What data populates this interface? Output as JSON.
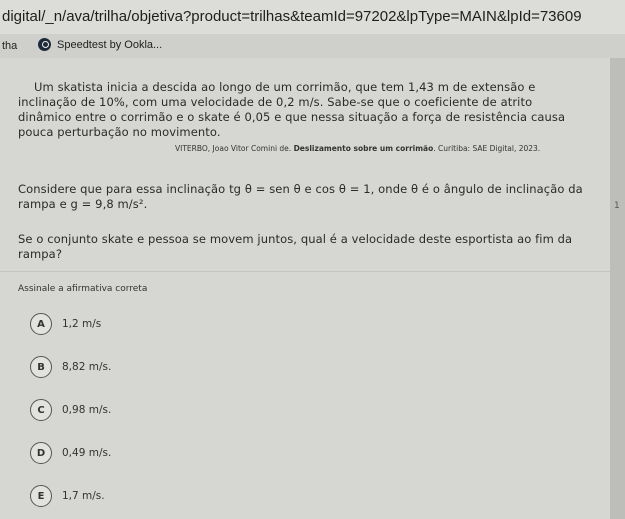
{
  "browser": {
    "url": "digital/_n/ava/trilha/objetiva?product=trilhas&teamId=97202&lpType=MAIN&lpId=73609",
    "bookmark_left": "tha",
    "bookmark_item": "Speedtest by Ookla..."
  },
  "question": {
    "paragraph1": "Um skatista inicia a descida ao longo de um corrimão, que tem 1,43 m de extensão e inclinação de 10%, com uma velocidade de 0,2 m/s. Sabe-se que o coeficiente de atrito dinâmico entre o corrimão e o skate é 0,05 e que nessa situação a força de resistência causa pouca perturbação no movimento.",
    "citation_pre": "VITERBO, Joao Vitor Comini de.",
    "citation_title": "Deslizamento sobre um corrimão",
    "citation_post": ". Curitiba: SAE Digital, 2023.",
    "paragraph2": "Considere que para essa inclinação tg θ = sen θ e cos θ = 1, onde θ é o ângulo de inclinação da rampa e g = 9,8 m/s².",
    "paragraph3": "Se o conjunto skate e pessoa se movem juntos, qual é a velocidade deste esportista ao fim da rampa?",
    "instruction": "Assinale a afirmativa correta"
  },
  "options": [
    {
      "letter": "A",
      "text": "1,2 m/s"
    },
    {
      "letter": "B",
      "text": "8,82 m/s."
    },
    {
      "letter": "C",
      "text": "0,98 m/s."
    },
    {
      "letter": "D",
      "text": "0,49 m/s."
    },
    {
      "letter": "E",
      "text": "1,7 m/s."
    }
  ],
  "side_mark": "1"
}
